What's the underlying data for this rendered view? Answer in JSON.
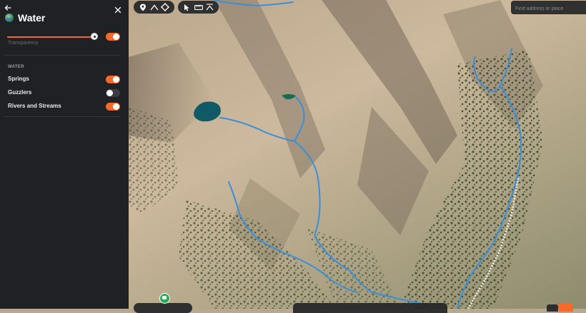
{
  "panel": {
    "title": "Water",
    "transparency_label": "Transparency",
    "transparency_value": 1.0,
    "transparency_toggle_on": true,
    "section_title": "WATER",
    "layers": [
      {
        "label": "Springs",
        "on": true
      },
      {
        "label": "Guzzlers",
        "on": false
      },
      {
        "label": "Rivers and Streams",
        "on": true
      }
    ]
  },
  "toolbar": {
    "tools_left": [
      "marker-icon",
      "line-icon",
      "polygon-icon"
    ],
    "tools_right": [
      "pointer-icon",
      "ruler-icon",
      "elevation-profile-icon"
    ]
  },
  "search": {
    "placeholder": "Find address or place",
    "value": ""
  },
  "colors": {
    "accent": "#f46a2b",
    "panel_bg": "#1f2124",
    "stream": "#3a8fd6",
    "lake": "#0f5a66"
  }
}
